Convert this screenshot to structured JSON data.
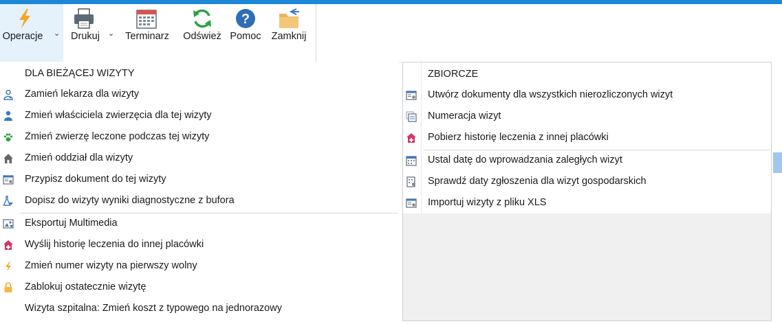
{
  "toolbar": {
    "operacje": "Operacje",
    "drukuj": "Drukuj",
    "terminarz": "Terminarz",
    "odswiez": "Odśwież",
    "pomoc": "Pomoc",
    "zamknij": "Zamknij",
    "chevron": "⌄"
  },
  "menu_left": {
    "header": "DLA BIEŻĄCEJ WIZYTY",
    "items": [
      "Zamień lekarza dla wizyty",
      "Zmień właściciela zwierzęcia dla tej wizyty",
      "Zmień zwierzę leczone podczas tej wizyty",
      "Zmień oddział dla wizyty",
      "Przypisz dokument do tej wizyty",
      "Dopisz do wizyty wyniki diagnostyczne z bufora",
      "Eksportuj Multimedia",
      "Wyślij historię leczenia do innej placówki",
      "Zmień numer wizyty na pierwszy wolny",
      "Zablokuj ostatecznie wizytę",
      "Wizyta szpitalna: Zmień koszt z typowego na jednorazowy"
    ]
  },
  "menu_right": {
    "header": "ZBIORCZE",
    "items": [
      "Utwórz dokumenty dla wszystkich nierozliczonych wizyt",
      "Numeracja wizyt",
      "Pobierz historię leczenia z innej placówki",
      "Ustal datę do wprowadzania zaległych wizyt",
      "Sprawdź daty zgłoszenia dla wizyt gospodarskich",
      "Importuj wizyty z pliku XLS"
    ]
  },
  "colors": {
    "accent": "#1e88d8",
    "active_button": "#e5f1fb",
    "icon_orange": "#f5a623",
    "icon_blue": "#3a78c2",
    "icon_green": "#2ea043",
    "icon_pink": "#d6336c"
  }
}
